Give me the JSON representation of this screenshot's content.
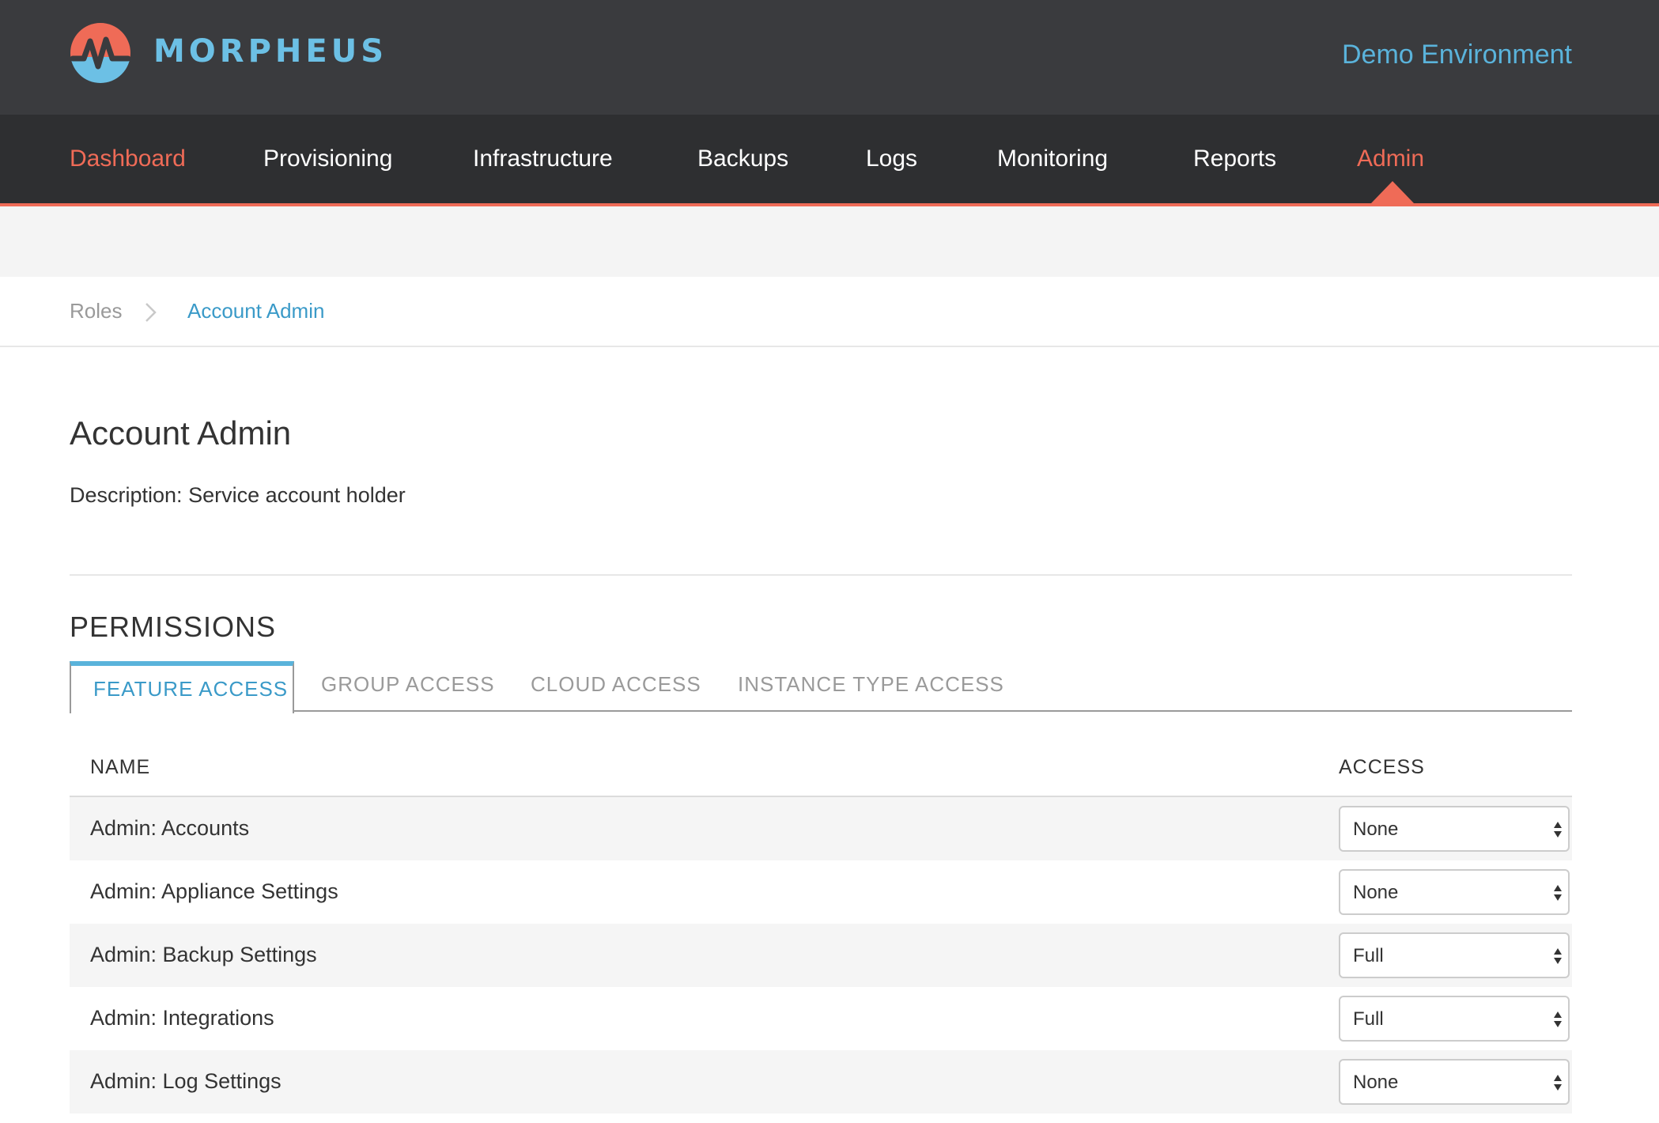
{
  "header": {
    "brand": "MORPHEUS",
    "environment": "Demo Environment",
    "colors": {
      "dark_bg": "#3a3b3e",
      "accent": "#ef6b57",
      "brand_blue": "#6cc0e5"
    }
  },
  "nav": {
    "items": [
      {
        "label": "Dashboard",
        "active": false
      },
      {
        "label": "Provisioning",
        "active": false
      },
      {
        "label": "Infrastructure",
        "active": false
      },
      {
        "label": "Backups",
        "active": false
      },
      {
        "label": "Logs",
        "active": false
      },
      {
        "label": "Monitoring",
        "active": false
      },
      {
        "label": "Reports",
        "active": false
      },
      {
        "label": "Admin",
        "active": true
      }
    ]
  },
  "breadcrumb": {
    "root": "Roles",
    "current": "Account Admin"
  },
  "page": {
    "title": "Account Admin",
    "description_label": "Description:",
    "description_value": "Service account holder"
  },
  "permissions": {
    "title": "PERMISSIONS",
    "tabs": [
      {
        "label": "FEATURE ACCESS",
        "active": true
      },
      {
        "label": "GROUP ACCESS",
        "active": false
      },
      {
        "label": "CLOUD ACCESS",
        "active": false
      },
      {
        "label": "INSTANCE TYPE ACCESS",
        "active": false
      }
    ],
    "columns": {
      "name": "NAME",
      "access": "ACCESS"
    },
    "rows": [
      {
        "name": "Admin: Accounts",
        "access": "None"
      },
      {
        "name": "Admin: Appliance Settings",
        "access": "None"
      },
      {
        "name": "Admin: Backup Settings",
        "access": "Full"
      },
      {
        "name": "Admin: Integrations",
        "access": "Full"
      },
      {
        "name": "Admin: Log Settings",
        "access": "None"
      }
    ]
  }
}
